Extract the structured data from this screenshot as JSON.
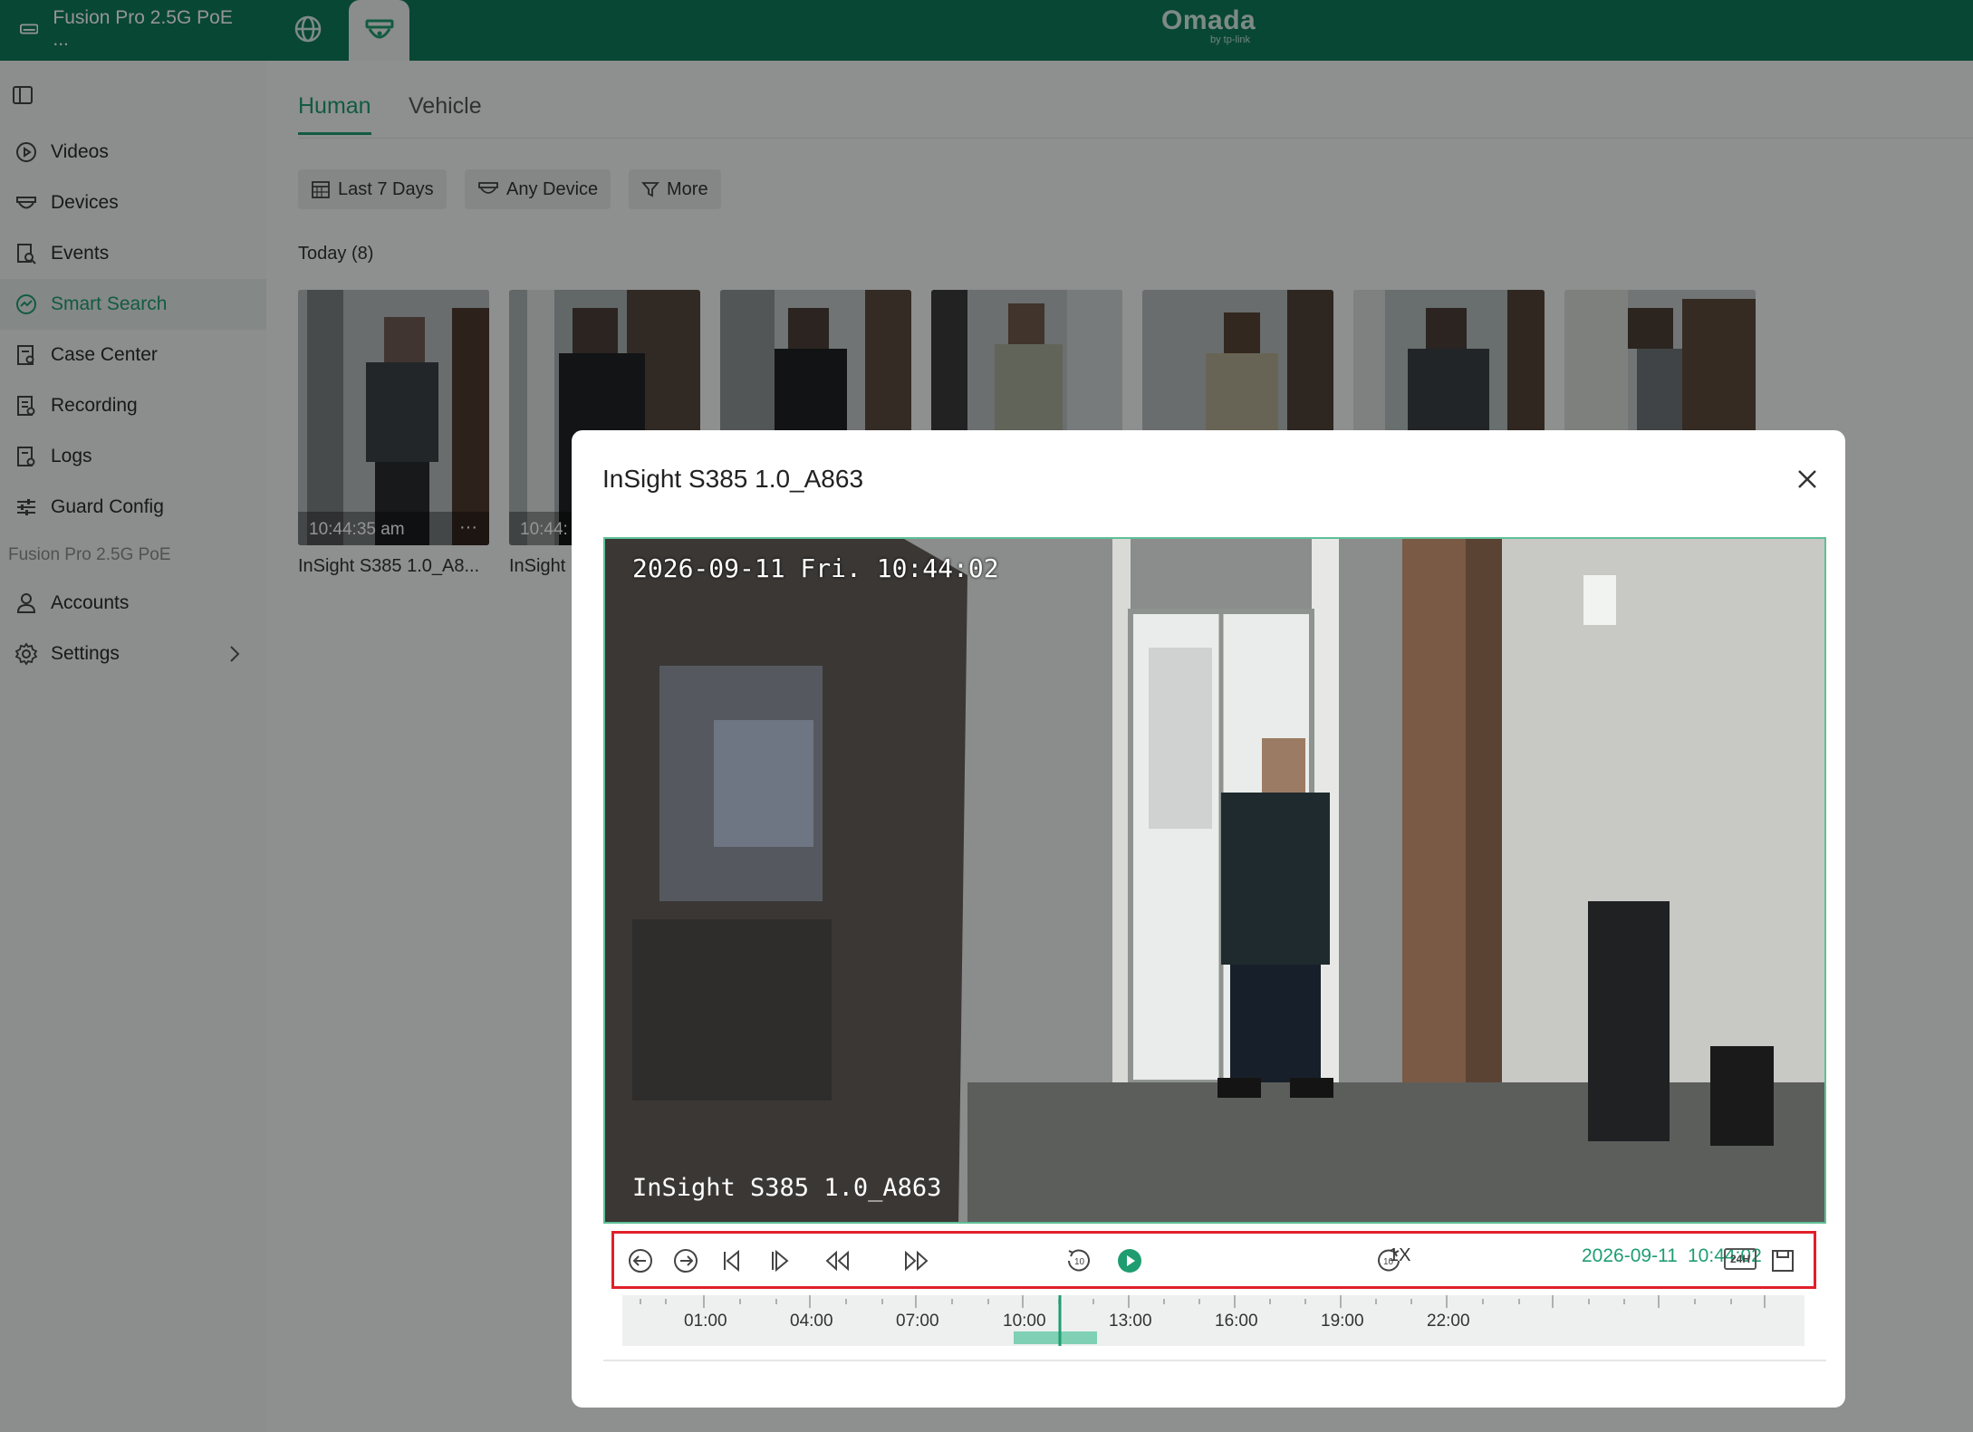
{
  "topbar": {
    "site_name": "Fusion Pro 2.5G PoE ...",
    "logo": "Omada",
    "logo_sub": "by tp-link",
    "brand_color": "#0f7a5a"
  },
  "sidebar": {
    "items": [
      {
        "label": "Videos",
        "icon": "play-circle-icon"
      },
      {
        "label": "Devices",
        "icon": "camera-icon"
      },
      {
        "label": "Events",
        "icon": "event-search-icon"
      },
      {
        "label": "Smart Search",
        "icon": "smart-search-icon",
        "active": true
      },
      {
        "label": "Case Center",
        "icon": "case-icon"
      },
      {
        "label": "Recording",
        "icon": "recording-icon"
      },
      {
        "label": "Logs",
        "icon": "logs-icon"
      },
      {
        "label": "Guard Config",
        "icon": "sliders-icon"
      }
    ],
    "section_label": "Fusion Pro 2.5G PoE",
    "section_items": [
      {
        "label": "Accounts",
        "icon": "user-icon"
      },
      {
        "label": "Settings",
        "icon": "gear-icon"
      }
    ]
  },
  "main": {
    "tabs": [
      {
        "label": "Human",
        "active": true
      },
      {
        "label": "Vehicle"
      }
    ],
    "filters": {
      "date": "Last 7 Days",
      "device": "Any Device",
      "more": "More"
    },
    "today_label": "Today",
    "today_count": "(8)",
    "thumbnails": [
      {
        "time": "10:44:35 am",
        "camera": "InSight S385 1.0_A8..."
      },
      {
        "time": "10:44:",
        "camera": "InSight"
      }
    ]
  },
  "modal": {
    "title": "InSight S385 1.0_A863",
    "osd_timestamp": "2026-09-11 Fri. 10:44:02",
    "osd_camera": "InSight S385 1.0_A863",
    "speed": "1X",
    "play_date": "2026-09-11",
    "play_time": "10:44:02",
    "badge_24h": "24H",
    "timeline_labels": [
      "01:00",
      "04:00",
      "07:00",
      "10:00",
      "13:00",
      "16:00",
      "19:00",
      "22:00"
    ],
    "accent_color": "#1f9d71",
    "highlight_color": "#e0202a"
  }
}
